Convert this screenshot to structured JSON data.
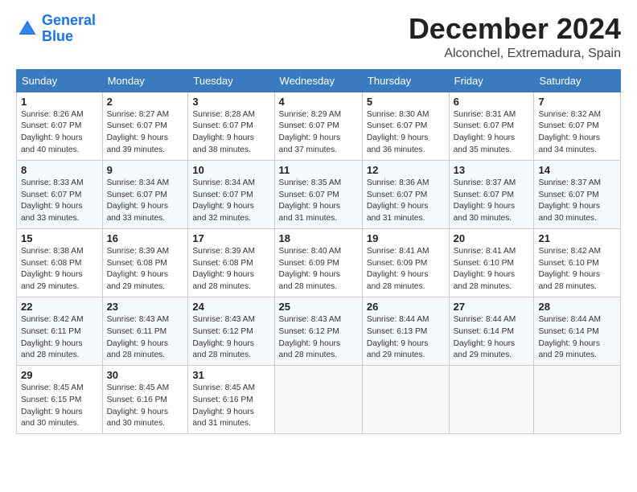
{
  "header": {
    "logo_line1": "General",
    "logo_line2": "Blue",
    "month": "December 2024",
    "location": "Alconchel, Extremadura, Spain"
  },
  "weekdays": [
    "Sunday",
    "Monday",
    "Tuesday",
    "Wednesday",
    "Thursday",
    "Friday",
    "Saturday"
  ],
  "weeks": [
    [
      {
        "day": "1",
        "info": "Sunrise: 8:26 AM\nSunset: 6:07 PM\nDaylight: 9 hours\nand 40 minutes."
      },
      {
        "day": "2",
        "info": "Sunrise: 8:27 AM\nSunset: 6:07 PM\nDaylight: 9 hours\nand 39 minutes."
      },
      {
        "day": "3",
        "info": "Sunrise: 8:28 AM\nSunset: 6:07 PM\nDaylight: 9 hours\nand 38 minutes."
      },
      {
        "day": "4",
        "info": "Sunrise: 8:29 AM\nSunset: 6:07 PM\nDaylight: 9 hours\nand 37 minutes."
      },
      {
        "day": "5",
        "info": "Sunrise: 8:30 AM\nSunset: 6:07 PM\nDaylight: 9 hours\nand 36 minutes."
      },
      {
        "day": "6",
        "info": "Sunrise: 8:31 AM\nSunset: 6:07 PM\nDaylight: 9 hours\nand 35 minutes."
      },
      {
        "day": "7",
        "info": "Sunrise: 8:32 AM\nSunset: 6:07 PM\nDaylight: 9 hours\nand 34 minutes."
      }
    ],
    [
      {
        "day": "8",
        "info": "Sunrise: 8:33 AM\nSunset: 6:07 PM\nDaylight: 9 hours\nand 33 minutes."
      },
      {
        "day": "9",
        "info": "Sunrise: 8:34 AM\nSunset: 6:07 PM\nDaylight: 9 hours\nand 33 minutes."
      },
      {
        "day": "10",
        "info": "Sunrise: 8:34 AM\nSunset: 6:07 PM\nDaylight: 9 hours\nand 32 minutes."
      },
      {
        "day": "11",
        "info": "Sunrise: 8:35 AM\nSunset: 6:07 PM\nDaylight: 9 hours\nand 31 minutes."
      },
      {
        "day": "12",
        "info": "Sunrise: 8:36 AM\nSunset: 6:07 PM\nDaylight: 9 hours\nand 31 minutes."
      },
      {
        "day": "13",
        "info": "Sunrise: 8:37 AM\nSunset: 6:07 PM\nDaylight: 9 hours\nand 30 minutes."
      },
      {
        "day": "14",
        "info": "Sunrise: 8:37 AM\nSunset: 6:07 PM\nDaylight: 9 hours\nand 30 minutes."
      }
    ],
    [
      {
        "day": "15",
        "info": "Sunrise: 8:38 AM\nSunset: 6:08 PM\nDaylight: 9 hours\nand 29 minutes."
      },
      {
        "day": "16",
        "info": "Sunrise: 8:39 AM\nSunset: 6:08 PM\nDaylight: 9 hours\nand 29 minutes."
      },
      {
        "day": "17",
        "info": "Sunrise: 8:39 AM\nSunset: 6:08 PM\nDaylight: 9 hours\nand 28 minutes."
      },
      {
        "day": "18",
        "info": "Sunrise: 8:40 AM\nSunset: 6:09 PM\nDaylight: 9 hours\nand 28 minutes."
      },
      {
        "day": "19",
        "info": "Sunrise: 8:41 AM\nSunset: 6:09 PM\nDaylight: 9 hours\nand 28 minutes."
      },
      {
        "day": "20",
        "info": "Sunrise: 8:41 AM\nSunset: 6:10 PM\nDaylight: 9 hours\nand 28 minutes."
      },
      {
        "day": "21",
        "info": "Sunrise: 8:42 AM\nSunset: 6:10 PM\nDaylight: 9 hours\nand 28 minutes."
      }
    ],
    [
      {
        "day": "22",
        "info": "Sunrise: 8:42 AM\nSunset: 6:11 PM\nDaylight: 9 hours\nand 28 minutes."
      },
      {
        "day": "23",
        "info": "Sunrise: 8:43 AM\nSunset: 6:11 PM\nDaylight: 9 hours\nand 28 minutes."
      },
      {
        "day": "24",
        "info": "Sunrise: 8:43 AM\nSunset: 6:12 PM\nDaylight: 9 hours\nand 28 minutes."
      },
      {
        "day": "25",
        "info": "Sunrise: 8:43 AM\nSunset: 6:12 PM\nDaylight: 9 hours\nand 28 minutes."
      },
      {
        "day": "26",
        "info": "Sunrise: 8:44 AM\nSunset: 6:13 PM\nDaylight: 9 hours\nand 29 minutes."
      },
      {
        "day": "27",
        "info": "Sunrise: 8:44 AM\nSunset: 6:14 PM\nDaylight: 9 hours\nand 29 minutes."
      },
      {
        "day": "28",
        "info": "Sunrise: 8:44 AM\nSunset: 6:14 PM\nDaylight: 9 hours\nand 29 minutes."
      }
    ],
    [
      {
        "day": "29",
        "info": "Sunrise: 8:45 AM\nSunset: 6:15 PM\nDaylight: 9 hours\nand 30 minutes."
      },
      {
        "day": "30",
        "info": "Sunrise: 8:45 AM\nSunset: 6:16 PM\nDaylight: 9 hours\nand 30 minutes."
      },
      {
        "day": "31",
        "info": "Sunrise: 8:45 AM\nSunset: 6:16 PM\nDaylight: 9 hours\nand 31 minutes."
      },
      null,
      null,
      null,
      null
    ]
  ]
}
